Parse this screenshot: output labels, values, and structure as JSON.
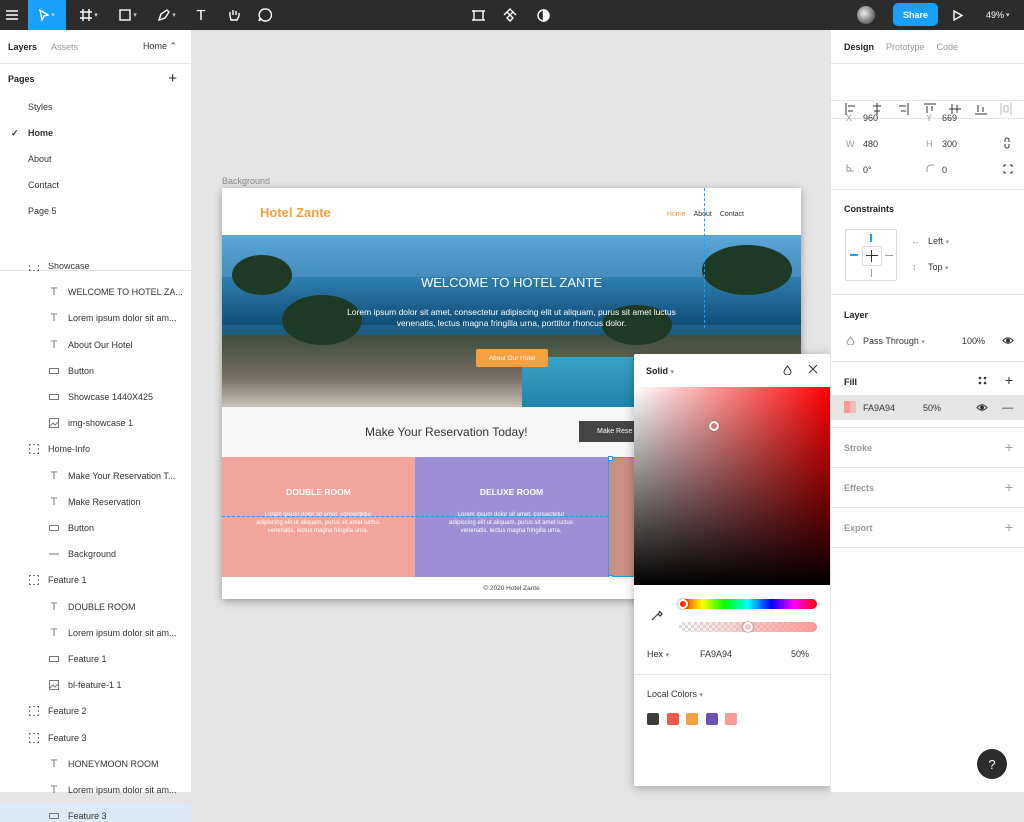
{
  "toolbar": {
    "share_label": "Share",
    "zoom": "49%"
  },
  "left_panel": {
    "tab_layers": "Layers",
    "tab_assets": "Assets",
    "page_selector": "Home ⌃",
    "pages_heading": "Pages",
    "pages": [
      "Styles",
      "Home",
      "About",
      "Contact",
      "Page 5"
    ],
    "selected_page": "Home",
    "layers": [
      {
        "label": "Showcase",
        "type": "frame",
        "indent": 1
      },
      {
        "label": "WELCOME TO HOTEL ZA...",
        "type": "text",
        "indent": 2
      },
      {
        "label": "Lorem ipsum dolor sit am...",
        "type": "text",
        "indent": 2
      },
      {
        "label": "About Our Hotel",
        "type": "text",
        "indent": 2
      },
      {
        "label": "Button",
        "type": "rect",
        "indent": 2
      },
      {
        "label": "Showcase 1440X425",
        "type": "rect",
        "indent": 2
      },
      {
        "label": "img-showcase 1",
        "type": "image",
        "indent": 2
      },
      {
        "label": "Home-Info",
        "type": "frame",
        "indent": 1
      },
      {
        "label": "Make Your Reservation T...",
        "type": "text",
        "indent": 2
      },
      {
        "label": "Make Reservation",
        "type": "text",
        "indent": 2
      },
      {
        "label": "Button",
        "type": "rect",
        "indent": 2
      },
      {
        "label": "Background",
        "type": "line",
        "indent": 2
      },
      {
        "label": "Feature 1",
        "type": "frame",
        "indent": 1
      },
      {
        "label": "DOUBLE ROOM",
        "type": "text",
        "indent": 2
      },
      {
        "label": "Lorem ipsum dolor sit am...",
        "type": "text",
        "indent": 2
      },
      {
        "label": "Feature 1",
        "type": "rect",
        "indent": 2
      },
      {
        "label": "bl-feature-1 1",
        "type": "image",
        "indent": 2
      },
      {
        "label": "Feature 2",
        "type": "frame",
        "indent": 1
      },
      {
        "label": "Feature 3",
        "type": "frame",
        "indent": 1
      },
      {
        "label": "HONEYMOON ROOM",
        "type": "text",
        "indent": 2
      },
      {
        "label": "Lorem ipsum dolor sit am...",
        "type": "text",
        "indent": 2
      },
      {
        "label": "Feature 3",
        "type": "rect",
        "indent": 2,
        "selected": true
      }
    ]
  },
  "canvas": {
    "frame_label": "Background",
    "site": {
      "logo": "Hotel Zante",
      "nav": [
        "Home",
        "About",
        "Contact"
      ],
      "hero_title": "WELCOME TO HOTEL ZANTE",
      "hero_text": "Lorem ipsum dolor sit amet, consectetur adipiscing elit ut aliquam, purus sit amet luctus venenatis, lectus magna fringilla urna, porttitor rhoncus dolor.",
      "hero_button": "About Our Hotel",
      "reservation_text": "Make Your Reservation Today!",
      "reservation_button": "Make Rese",
      "features": [
        {
          "title": "DOUBLE ROOM",
          "text": "Lorem ipsum dolor sit amet, consectetur adipiscing elit ut aliquam, purus sit amet luctus venenatis, lectus magna fringilla urna.",
          "color": "#f3a59d"
        },
        {
          "title": "DELUXE ROOM",
          "text": "Lorem ipsum dolor sit amet, consectetur adipiscing elit ut aliquam, purus sit amet luctus venenatis, lectus magna fringilla urna.",
          "color": "#9d8fd6"
        }
      ],
      "footer": "© 2020 Hotel Zante"
    }
  },
  "color_picker": {
    "mode": "Solid",
    "format": "Hex",
    "hex": "FA9A94",
    "opacity": "50%",
    "local_colors_label": "Local Colors",
    "local_colors": [
      "#3d3d3d",
      "#f2574c",
      "#f7a03f",
      "#6c4fb5",
      "#fa9a94"
    ]
  },
  "design_panel": {
    "tab_design": "Design",
    "tab_prototype": "Prototype",
    "tab_code": "Code",
    "x_label": "X",
    "x": "960",
    "y_label": "Y",
    "y": "669",
    "w_label": "W",
    "w": "480",
    "h_label": "H",
    "h": "300",
    "rotation": "0°",
    "radius": "0",
    "constraints_heading": "Constraints",
    "constraint_h": "Left",
    "constraint_v": "Top",
    "layer_heading": "Layer",
    "blend": "Pass Through",
    "layer_opacity": "100%",
    "fill_heading": "Fill",
    "fill_hex": "FA9A94",
    "fill_opacity": "50%",
    "fill_color": "#fa9a94",
    "stroke_heading": "Stroke",
    "effects_heading": "Effects",
    "export_heading": "Export"
  },
  "help_label": "?"
}
